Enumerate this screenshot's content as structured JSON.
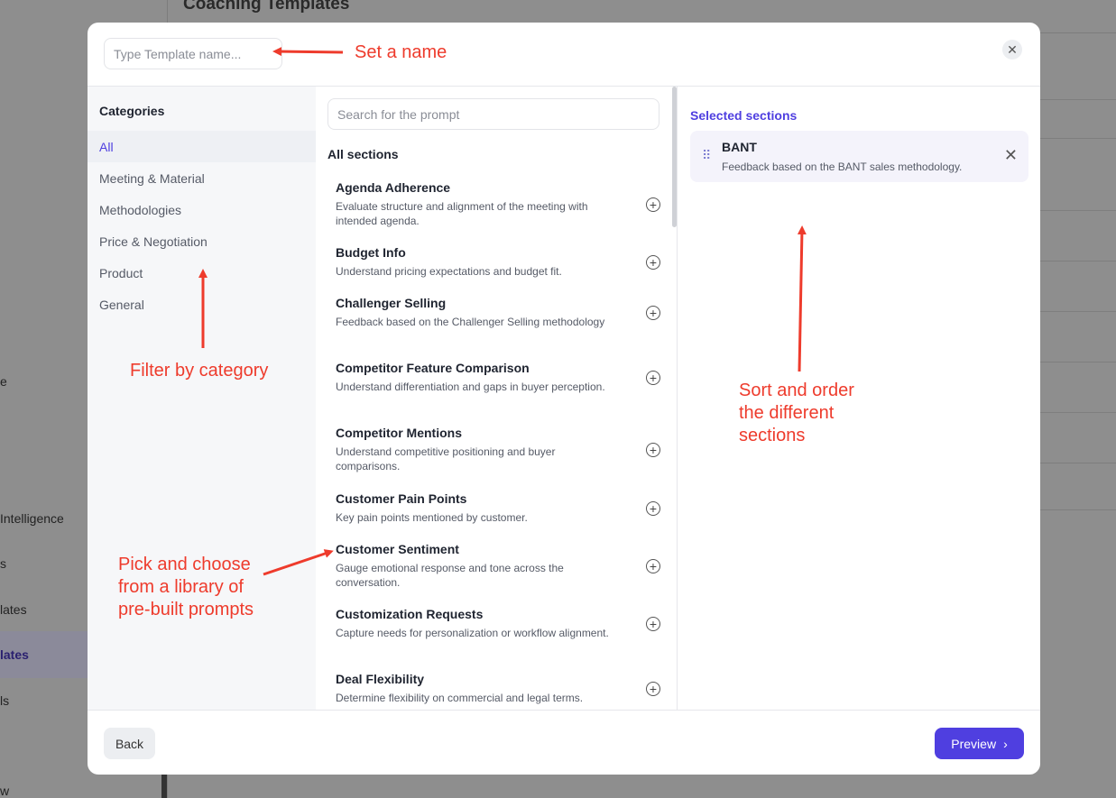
{
  "background": {
    "title": "Coaching Templates",
    "sidebar_fragments": [
      "e",
      "Intelligence",
      "s",
      "lates",
      "lates",
      "ls",
      "w"
    ]
  },
  "modal": {
    "name_placeholder": "Type Template name...",
    "close_icon": "close-icon",
    "categories": {
      "heading": "Categories",
      "items": [
        {
          "label": "All",
          "active": true
        },
        {
          "label": "Meeting & Material",
          "active": false
        },
        {
          "label": "Methodologies",
          "active": false
        },
        {
          "label": "Price & Negotiation",
          "active": false
        },
        {
          "label": "Product",
          "active": false
        },
        {
          "label": "General",
          "active": false
        }
      ]
    },
    "library": {
      "search_placeholder": "Search for the prompt",
      "heading": "All sections",
      "prompts": [
        {
          "title": "Agenda Adherence",
          "desc": "Evaluate structure and alignment of the meeting with intended agenda."
        },
        {
          "title": "Budget Info",
          "desc": "Understand pricing expectations and budget fit."
        },
        {
          "title": "Challenger Selling",
          "desc": "Feedback based on the Challenger Selling methodology"
        },
        {
          "title": "Competitor Feature Comparison",
          "desc": "Understand differentiation and gaps in buyer perception."
        },
        {
          "title": "Competitor Mentions",
          "desc": "Understand competitive positioning and buyer comparisons."
        },
        {
          "title": "Customer Pain Points",
          "desc": "Key pain points mentioned by customer."
        },
        {
          "title": "Customer Sentiment",
          "desc": "Gauge emotional response and tone across the conversation."
        },
        {
          "title": "Customization Requests",
          "desc": "Capture needs for personalization or workflow alignment."
        },
        {
          "title": "Deal Flexibility",
          "desc": "Determine flexibility on commercial and legal terms."
        }
      ]
    },
    "selected": {
      "heading": "Selected sections",
      "items": [
        {
          "title": "BANT",
          "desc": "Feedback based on the BANT sales methodology."
        }
      ]
    },
    "footer": {
      "back_label": "Back",
      "preview_label": "Preview"
    }
  },
  "annotations": {
    "set_name": "Set a name",
    "filter": "Filter by category",
    "sort": "Sort and order\nthe different\nsections",
    "pick": "Pick and choose\nfrom a library of\npre-built prompts"
  },
  "colors": {
    "accent": "#4f3fe0",
    "annotation": "#ee3b2c"
  }
}
